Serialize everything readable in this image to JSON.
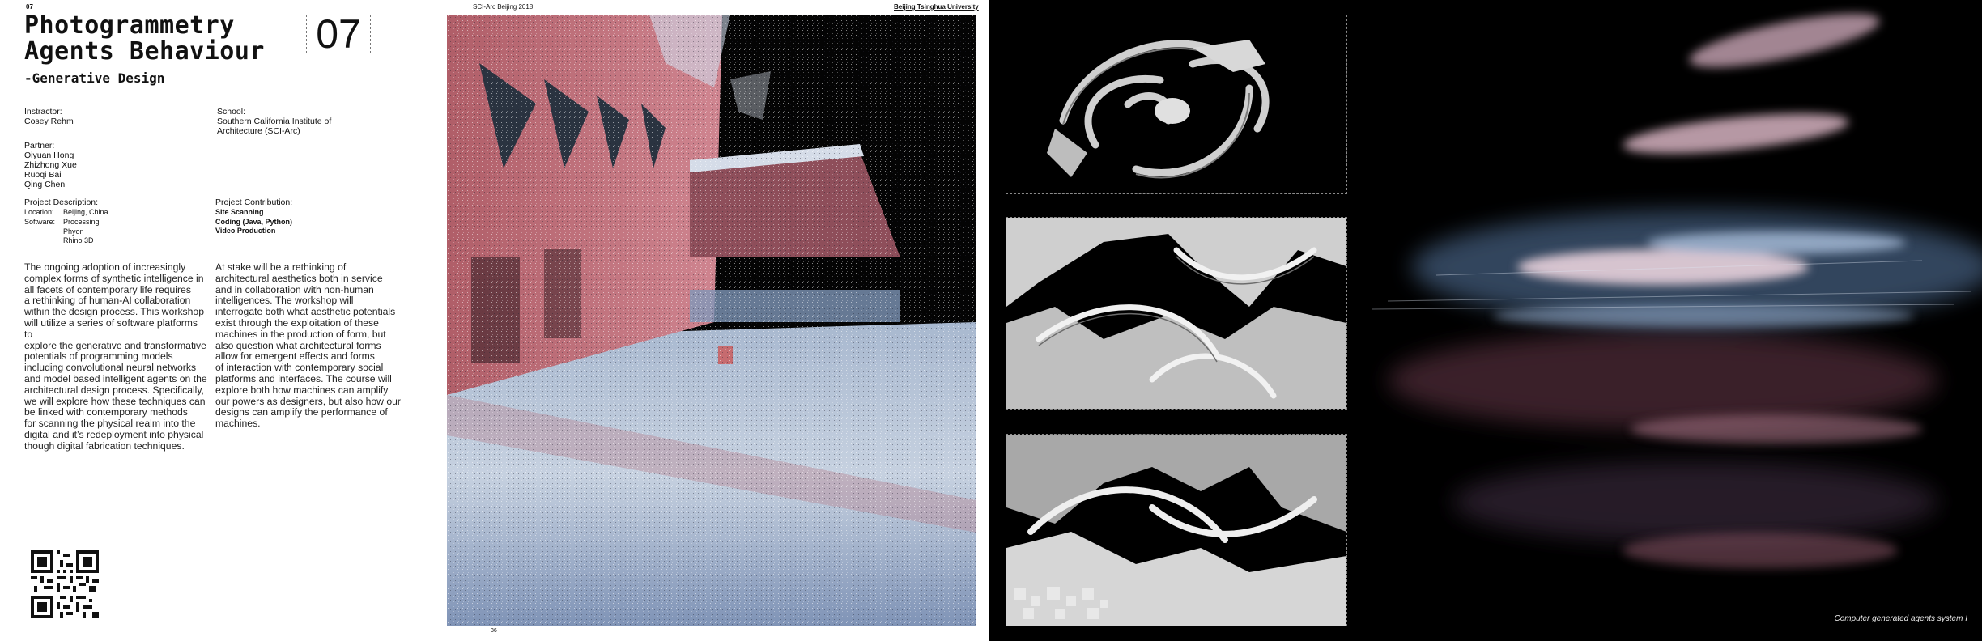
{
  "header": {
    "page_number": "07",
    "left_small": "SCI-Arc Beijing 2018",
    "right_small": "Beijing Tsinghua University"
  },
  "title": {
    "line1": "Photogrammetry",
    "line2": "Agents Behaviour",
    "subtitle": "-Generative Design",
    "big_number": "07"
  },
  "meta": {
    "instructor_label": "Instractor:",
    "instructor": "Cosey Rehm",
    "school_label": "School:",
    "school_line1": "Southern California Institute of",
    "school_line2": "Architecture (SCI-Arc)",
    "partner_label": "Partner:",
    "partners": [
      "Qiyuan Hong",
      "Zhizhong Xue",
      "Ruoqi Bai",
      "Qing Chen"
    ],
    "project_description_label": "Project Description:",
    "location_label": "Location:",
    "location": "Beijing, China",
    "software_label": "Software:",
    "software": [
      "Processing",
      "Phyon",
      "Rhino 3D"
    ],
    "project_contribution_label": "Project Contribution:",
    "contributions": [
      "Site Scanning",
      "Coding (Java, Python)",
      "Video Production"
    ]
  },
  "body": {
    "col1": [
      "The ongoing adoption of increasingly",
      "complex forms of synthetic intelligence in",
      "all facets of contemporary life requires",
      "a rethinking of human-AI collaboration",
      "within the design process. This workshop",
      "will utilize a series of software platforms to",
      "explore the generative and transformative",
      "potentials of programming models",
      "including convolutional neural networks",
      "and model based intelligent agents on the",
      "architectural design process. Specifically,",
      "we will explore how these techniques can",
      "be linked with contemporary methods",
      "for scanning the physical realm into the",
      "digital and it’s redeployment into physical",
      "though digital fabrication techniques."
    ],
    "col2": [
      "At stake will be a rethinking of",
      "architectural aesthetics both in service",
      "and in collaboration with non-human",
      "intelligences. The workshop will",
      "interrogate both what aesthetic potentials",
      "exist through the exploitation of these",
      "machines in the production of form, but",
      "also question what architectural forms",
      "allow for emergent effects and forms",
      "of interaction with contemporary social",
      "platforms and interfaces. The course will",
      "explore both how machines can amplify",
      "our powers as designers, but also how our",
      "designs can amplify the performance of",
      "machines."
    ]
  },
  "folio": "36",
  "caption": "Computer generated agents system I",
  "colors": {
    "pink_scan": "#c8707a",
    "blue_scan": "#9fb6d6",
    "render_gray": "#bdbdbd"
  }
}
